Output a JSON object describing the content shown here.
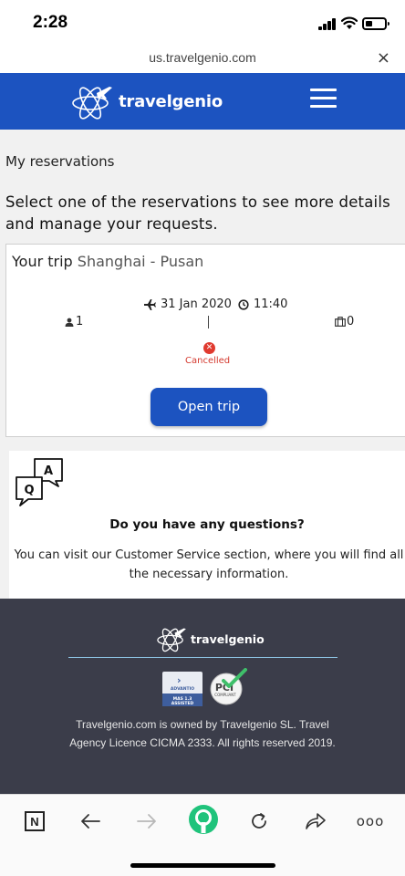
{
  "status_bar": {
    "time": "2:28"
  },
  "browser": {
    "url": "us.travelgenio.com",
    "close_symbol": "×"
  },
  "header": {
    "brand": "travelgenio",
    "brand_color": "#1c53c0"
  },
  "page": {
    "title": "My reservations",
    "intro": "Select one of the reservations to see more details and manage your requests."
  },
  "reservation": {
    "label": "Your trip",
    "route": "Shanghai - Pusan",
    "date": "31 Jan 2020",
    "time": "11:40",
    "passengers": "1",
    "bags": "0",
    "status": "Cancelled",
    "status_color": "#e03a2f",
    "button": "Open trip"
  },
  "questions": {
    "icon_letters": [
      "Q",
      "A"
    ],
    "heading": "Do you have any questions?",
    "text": "You can visit our Customer Service section, where you will find all the necessary information."
  },
  "footer": {
    "brand": "travelgenio",
    "advantio_badge": [
      "ADVANTIO",
      "MAS 1.3",
      "ASSISTED"
    ],
    "pci_badge": [
      "PCI",
      "COMPLIANT"
    ],
    "text": "Travelgenio.com is owned by Travelgenio SL. Travel Agency Licence CICMA 2333. All rights reserved 2019."
  },
  "toolbar": {
    "n_label": "N",
    "more_label": "ooo",
    "icons": [
      "n-icon",
      "back-arrow-icon",
      "forward-arrow-icon",
      "home-icon",
      "reload-icon",
      "share-icon",
      "more-icon"
    ]
  }
}
